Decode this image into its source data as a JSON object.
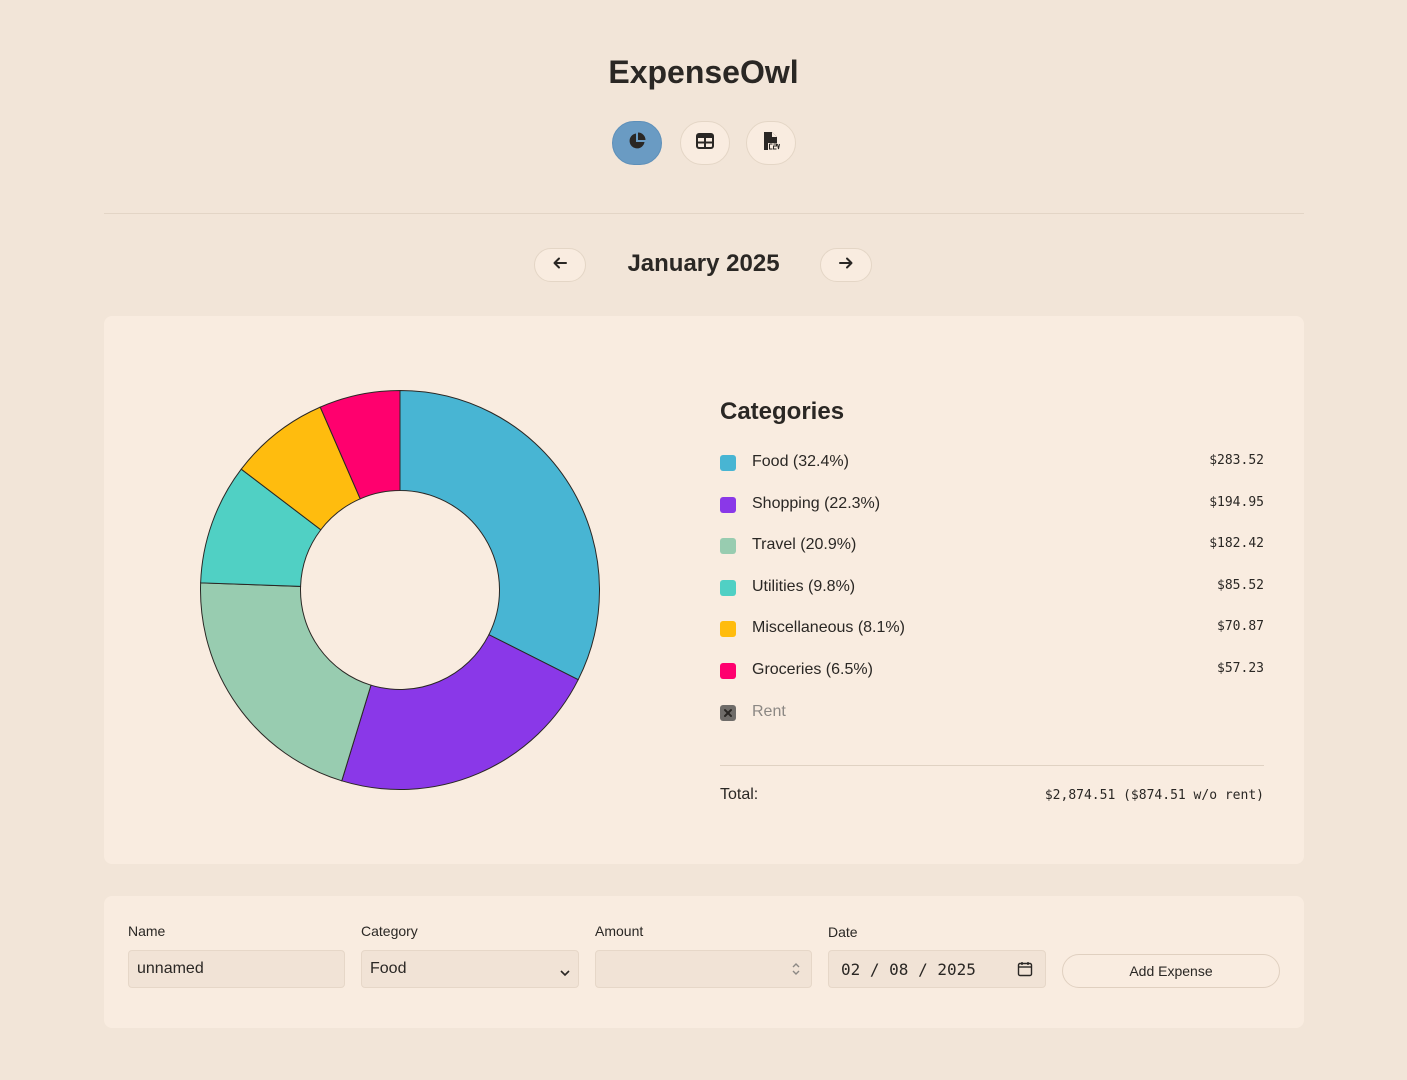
{
  "app": {
    "title": "ExpenseOwl"
  },
  "month_nav": {
    "title": "January 2025"
  },
  "legend": {
    "title": "Categories",
    "items": [
      {
        "label": "Food (32.4%)",
        "amount": "$283.52",
        "color": "#48b5d3",
        "hidden": false
      },
      {
        "label": "Shopping (22.3%)",
        "amount": "$194.95",
        "color": "#8a38e8",
        "hidden": false
      },
      {
        "label": "Travel (20.9%)",
        "amount": "$182.42",
        "color": "#98ccb0",
        "hidden": false
      },
      {
        "label": "Utilities (9.8%)",
        "amount": "$85.52",
        "color": "#50d0c4",
        "hidden": false
      },
      {
        "label": "Miscellaneous (8.1%)",
        "amount": "$70.87",
        "color": "#ffbc0e",
        "hidden": false
      },
      {
        "label": "Groceries (6.5%)",
        "amount": "$57.23",
        "color": "#ff006e",
        "hidden": false
      },
      {
        "label": "Rent",
        "amount": "",
        "color": "#6f6c69",
        "hidden": true
      }
    ],
    "total_label": "Total:",
    "total_value": "$2,874.51 ($874.51 w/o rent)"
  },
  "chart_data": {
    "type": "pie",
    "categories": [
      "Food",
      "Shopping",
      "Travel",
      "Utilities",
      "Miscellaneous",
      "Groceries"
    ],
    "values": [
      283.52,
      194.95,
      182.42,
      85.52,
      70.87,
      57.23
    ],
    "colors": [
      "#48b5d3",
      "#8a38e8",
      "#98ccb0",
      "#50d0c4",
      "#ffbc0e",
      "#ff006e"
    ],
    "legend": "right"
  },
  "form": {
    "name_label": "Name",
    "name_value": "unnamed",
    "category_label": "Category",
    "category_value": "Food",
    "amount_label": "Amount",
    "amount_value": "",
    "date_label": "Date",
    "date_value": "02 / 08 / 2025",
    "submit_label": "Add Expense"
  },
  "icons": {
    "chart_view": "pie-chart-icon",
    "table_view": "table-icon",
    "export": "csv-file-icon",
    "prev": "arrow-left-icon",
    "next": "arrow-right-icon",
    "calendar": "calendar-icon",
    "select": "chevron-down-icon",
    "stepper": "stepper-icon",
    "hidden": "x-icon"
  }
}
